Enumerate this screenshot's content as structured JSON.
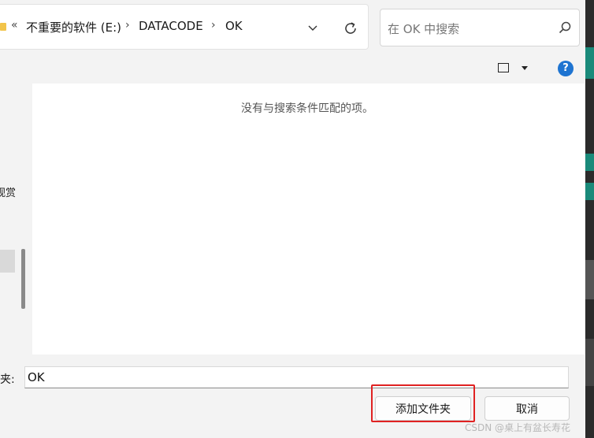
{
  "address_bar": {
    "overflow": "«",
    "crumbs": [
      "不重要的软件 (E:)",
      "DATACODE",
      "OK"
    ]
  },
  "search": {
    "placeholder": "在 OK 中搜索"
  },
  "toolbar": {
    "help": "?"
  },
  "nav": {
    "partial_item": "视赏"
  },
  "content": {
    "empty_message": "没有与搜索条件匹配的项。"
  },
  "footer": {
    "folder_label": "夹:",
    "folder_value": "OK",
    "primary_button": "添加文件夹",
    "cancel_button": "取消"
  },
  "watermark": "CSDN @桌上有盆长寿花",
  "colors": {
    "accent": "#1e74d1",
    "highlight": "#e02222",
    "folder": "#f2c44a"
  }
}
